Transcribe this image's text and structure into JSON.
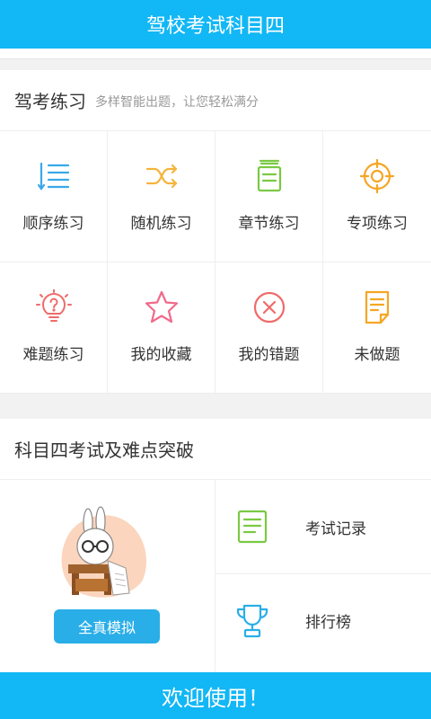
{
  "app": {
    "title": "驾校考试科目四"
  },
  "practice": {
    "title": "驾考练习",
    "subtitle": "多样智能出题，让您轻松满分",
    "items": [
      {
        "label": "顺序练习",
        "icon": "list-icon",
        "color": "#3aa9e8"
      },
      {
        "label": "随机练习",
        "icon": "shuffle-icon",
        "color": "#f5b43b"
      },
      {
        "label": "章节练习",
        "icon": "chapter-icon",
        "color": "#7ac943"
      },
      {
        "label": "专项练习",
        "icon": "target-icon",
        "color": "#f5a623"
      },
      {
        "label": "难题练习",
        "icon": "lightbulb-question-icon",
        "color": "#f06a6a"
      },
      {
        "label": "我的收藏",
        "icon": "star-icon",
        "color": "#f06a8a"
      },
      {
        "label": "我的错题",
        "icon": "error-x-icon",
        "color": "#f06a6a"
      },
      {
        "label": "未做题",
        "icon": "document-icon",
        "color": "#f5a623"
      }
    ]
  },
  "exam": {
    "title": "科目四考试及难点突破",
    "mock_button": "全真模拟",
    "record_label": "考试记录",
    "ranking_label": "排行榜"
  },
  "footer": {
    "text": "欢迎使用！"
  }
}
